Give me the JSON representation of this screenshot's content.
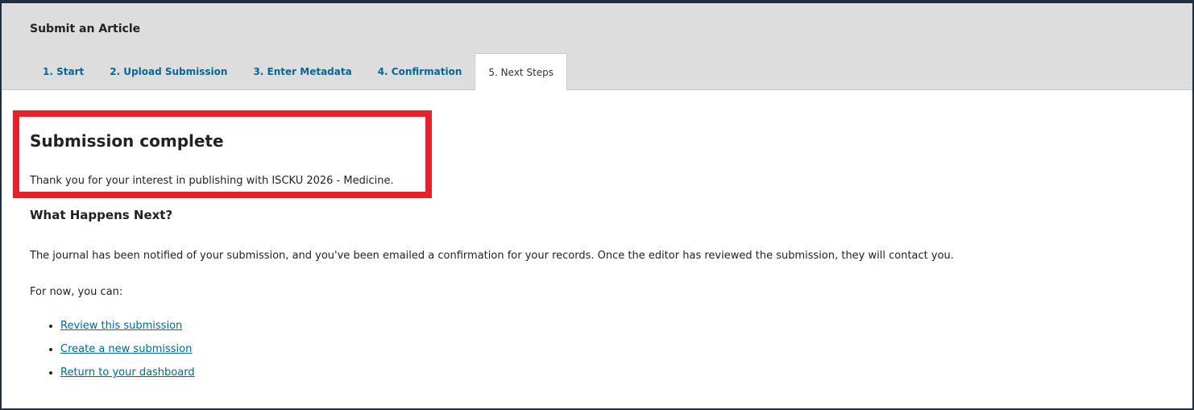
{
  "header": {
    "title": "Submit an Article",
    "tabs": [
      {
        "label": "1. Start"
      },
      {
        "label": "2. Upload Submission"
      },
      {
        "label": "3. Enter Metadata"
      },
      {
        "label": "4. Confirmation"
      },
      {
        "label": "5. Next Steps"
      }
    ],
    "active_tab": "5. Next Steps"
  },
  "main": {
    "heading": "Submission complete",
    "thanks_text": "Thank you for your interest in publishing with ISCKU 2026 - Medicine.",
    "next_heading": "What Happens Next?",
    "notified_text": "The journal has been notified of your submission, and you've been emailed a confirmation for your records. Once the editor has reviewed the submission, they will contact you.",
    "for_now_text": "For now, you can:",
    "links": [
      {
        "label": "Review this submission"
      },
      {
        "label": "Create a new submission"
      },
      {
        "label": "Return to your dashboard"
      }
    ]
  },
  "colors": {
    "link": "#006798",
    "highlight": "#e8202a",
    "header_bg": "#dddddd"
  }
}
